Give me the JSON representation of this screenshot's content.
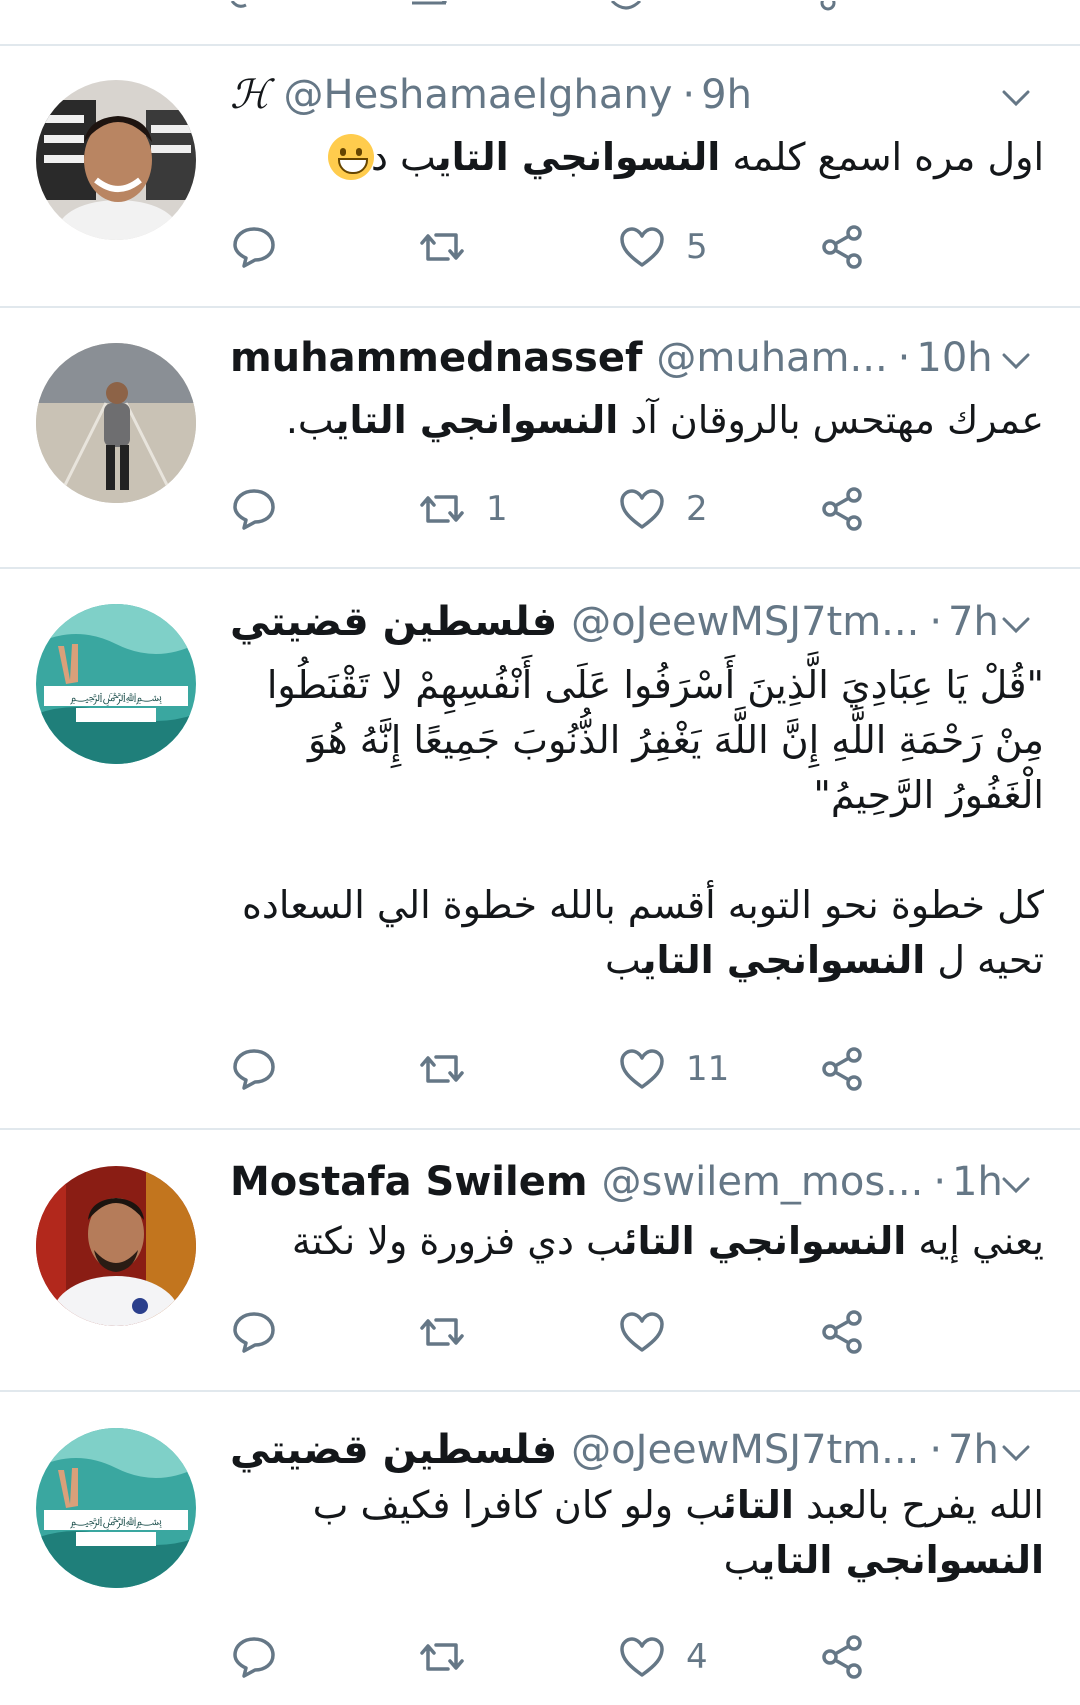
{
  "colors": {
    "accent": "#1da1f2",
    "secondary_text": "#657786",
    "divider": "#e1e8ed",
    "icon": "#657786"
  },
  "tweets": [
    {
      "display_name": "ℋ",
      "handle": "@Heshamaelghany",
      "time": "9h",
      "lines": [
        "اول مره اسمع كلمه <b>النسوانجي التاي</b>ب دا"
      ],
      "emoji": "grinning-face-icon",
      "counts": {
        "reply": "",
        "retweet": "",
        "like": "5"
      }
    },
    {
      "display_name": "muhammednassef",
      "handle": "@muham...",
      "time": "10h",
      "lines": [
        "عمرك مهتحس بالروقان آد <b>النسوانجي التاي</b>ب."
      ],
      "counts": {
        "reply": "",
        "retweet": "1",
        "like": "2"
      }
    },
    {
      "display_name": "فلسطين قضيتي",
      "handle": "@oJeewMSJ7tm...",
      "time": "7h",
      "lines": [
        "\"قُلْ يَا عِبَادِيَ الَّذِينَ أَسْرَفُوا عَلَى أَنْفُسِهِمْ لا تَقْنَطُوا",
        "مِنْ رَحْمَةِ اللَّهِ إِنَّ اللَّهَ يَغْفِرُ الذُّنُوبَ جَمِيعًا إِنَّهُ هُوَ",
        "الْغَفُورُ الرَّحِيمُ\"",
        "",
        "كل خطوة  نحو التوبه أقسم بالله خطوة الي السعاده",
        "تحيه ل <b>النسوانجي التاي</b>ب"
      ],
      "counts": {
        "reply": "",
        "retweet": "",
        "like": "11"
      }
    },
    {
      "display_name": "Mostafa Swilem",
      "handle": "@swilem_mos...",
      "time": "1h",
      "lines": [
        "يعني إيه <b>النسوانجي التائ</b>ب دي فزورة ولا نكتة"
      ],
      "counts": {
        "reply": "",
        "retweet": "",
        "like": ""
      }
    },
    {
      "display_name": "فلسطين قضيتي",
      "handle": "@oJeewMSJ7tm...",
      "time": "7h",
      "lines": [
        "الله يفرح بالعبد <b>التائ</b>ب ولو كان كافرا فكيف ب",
        "<b>النسوانجي التاي</b>ب"
      ],
      "counts": {
        "reply": "",
        "retweet": "",
        "like": "4"
      }
    }
  ]
}
